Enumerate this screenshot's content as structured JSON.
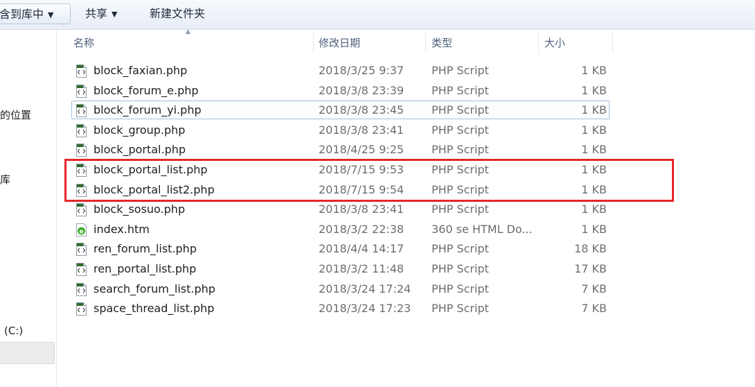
{
  "toolbar": {
    "include_library_label": "含到库中",
    "share_label": "共享",
    "new_folder_label": "新建文件夹"
  },
  "nav": {
    "items": [
      "的位置",
      "库",
      "(C:)"
    ]
  },
  "columns": {
    "name": "名称",
    "date": "修改日期",
    "type": "类型",
    "size": "大小"
  },
  "files": [
    {
      "name": "block_faxian.php",
      "date": "2018/3/25 9:37",
      "type": "PHP Script",
      "size": "1 KB",
      "icon": "php-file-icon"
    },
    {
      "name": "block_forum_e.php",
      "date": "2018/3/8 23:39",
      "type": "PHP Script",
      "size": "1 KB",
      "icon": "php-file-icon"
    },
    {
      "name": "block_forum_yi.php",
      "date": "2018/3/8 23:45",
      "type": "PHP Script",
      "size": "1 KB",
      "icon": "php-file-icon"
    },
    {
      "name": "block_group.php",
      "date": "2018/3/8 23:41",
      "type": "PHP Script",
      "size": "1 KB",
      "icon": "php-file-icon"
    },
    {
      "name": "block_portal.php",
      "date": "2018/4/25 9:25",
      "type": "PHP Script",
      "size": "1 KB",
      "icon": "php-file-icon"
    },
    {
      "name": "block_portal_list.php",
      "date": "2018/7/15 9:53",
      "type": "PHP Script",
      "size": "1 KB",
      "icon": "php-file-icon"
    },
    {
      "name": "block_portal_list2.php",
      "date": "2018/7/15 9:54",
      "type": "PHP Script",
      "size": "1 KB",
      "icon": "php-file-icon"
    },
    {
      "name": "block_sosuo.php",
      "date": "2018/3/8 23:41",
      "type": "PHP Script",
      "size": "1 KB",
      "icon": "php-file-icon"
    },
    {
      "name": "index.htm",
      "date": "2018/3/2 22:38",
      "type": "360 se HTML Do...",
      "size": "1 KB",
      "icon": "html-file-icon"
    },
    {
      "name": "ren_forum_list.php",
      "date": "2018/4/4 14:17",
      "type": "PHP Script",
      "size": "18 KB",
      "icon": "php-file-icon"
    },
    {
      "name": "ren_portal_list.php",
      "date": "2018/3/2 11:48",
      "type": "PHP Script",
      "size": "17 KB",
      "icon": "php-file-icon"
    },
    {
      "name": "search_forum_list.php",
      "date": "2018/3/24 17:24",
      "type": "PHP Script",
      "size": "7 KB",
      "icon": "php-file-icon"
    },
    {
      "name": "space_thread_list.php",
      "date": "2018/3/24 17:23",
      "type": "PHP Script",
      "size": "7 KB",
      "icon": "php-file-icon"
    }
  ],
  "colors": {
    "highlight": "#e5262b",
    "header_text": "#4c607a",
    "focus_border": "#a3bfdc"
  }
}
